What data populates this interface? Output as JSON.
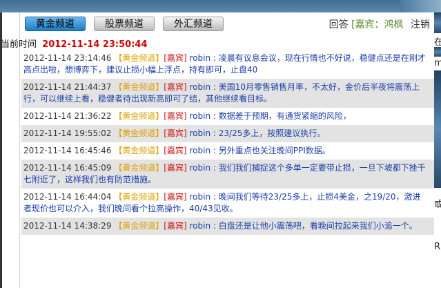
{
  "header": {
    "tabs": [
      {
        "label": "黄金频道",
        "active": true
      },
      {
        "label": "股票频道",
        "active": false
      },
      {
        "label": "外汇频道",
        "active": false
      }
    ],
    "answer_label": "回答",
    "guest_label": "[嘉宾：鸿枫",
    "logout_label": "注销"
  },
  "current_time": {
    "label": "当前时间",
    "value": "2012-11-14 23:50:44"
  },
  "messages": [
    {
      "time": "2012-11-14 23:14:46",
      "channel": "【黄金频道】",
      "role": "[嘉宾]",
      "user": "robin",
      "text": "凌晨有议息会议，现在行情也不好说，稳健点还是在刚才高点出啦，想博弈下，建议止损小幅上浮点，持有即可，止盘40"
    },
    {
      "time": "2012-11-14 21:44:37",
      "channel": "【黄金频道】",
      "role": "[嘉宾]",
      "user": "robin",
      "text": "美国10月零售销售月率，不太好，金价后半夜将震荡上行，可以继续上看，稳健者待出现新高即可了结，其他继续看目标。"
    },
    {
      "time": "2012-11-14 21:36:22",
      "channel": "【黄金频道】",
      "role": "[嘉宾]",
      "user": "robin",
      "text": "数据差于预期，有通货紧缩的风险，"
    },
    {
      "time": "2012-11-14 19:55:02",
      "channel": "【黄金频道】",
      "role": "[嘉宾]",
      "user": "robin",
      "text": "23/25多上，按照建议执行。"
    },
    {
      "time": "2012-11-14 16:45:46",
      "channel": "【黄金频道】",
      "role": "[嘉宾]",
      "user": "robin",
      "text": "另外重点也关注晚间PPI数据。"
    },
    {
      "time": "2012-11-14 16:45:09",
      "channel": "【黄金频道】",
      "role": "[嘉宾]",
      "user": "robin",
      "text": "我们我们捕捉这个多单一定要带止损，一旦下坡都下挫千七附近了，这样我们也有防范措施。"
    },
    {
      "time": "2012-11-14 16:44:04",
      "channel": "【黄金频道】",
      "role": "[嘉宾]",
      "user": "robin",
      "text": "晚间我们等待23/25多上，止损4美金，之19/20，激进者现价也可以介入，我们晚间看个拉高操作，40/43见收。"
    },
    {
      "time": "2012-11-14 14:38:29",
      "channel": "【黄金频道】",
      "role": "[嘉宾]",
      "user": "robin",
      "text": "白盘还是让他小震荡吧，看晚间拉起来我们小追一个。"
    }
  ],
  "right_fragments": [
    "在",
    "m",
    "或",
    "R"
  ],
  "colors": {
    "active_tab": "#1a7ec8",
    "channel_tag": "#e0a000",
    "role_tag": "#d01010",
    "message_text": "#1a3fa8",
    "current_time": "#d40000",
    "guest": "#5b8a2a"
  }
}
